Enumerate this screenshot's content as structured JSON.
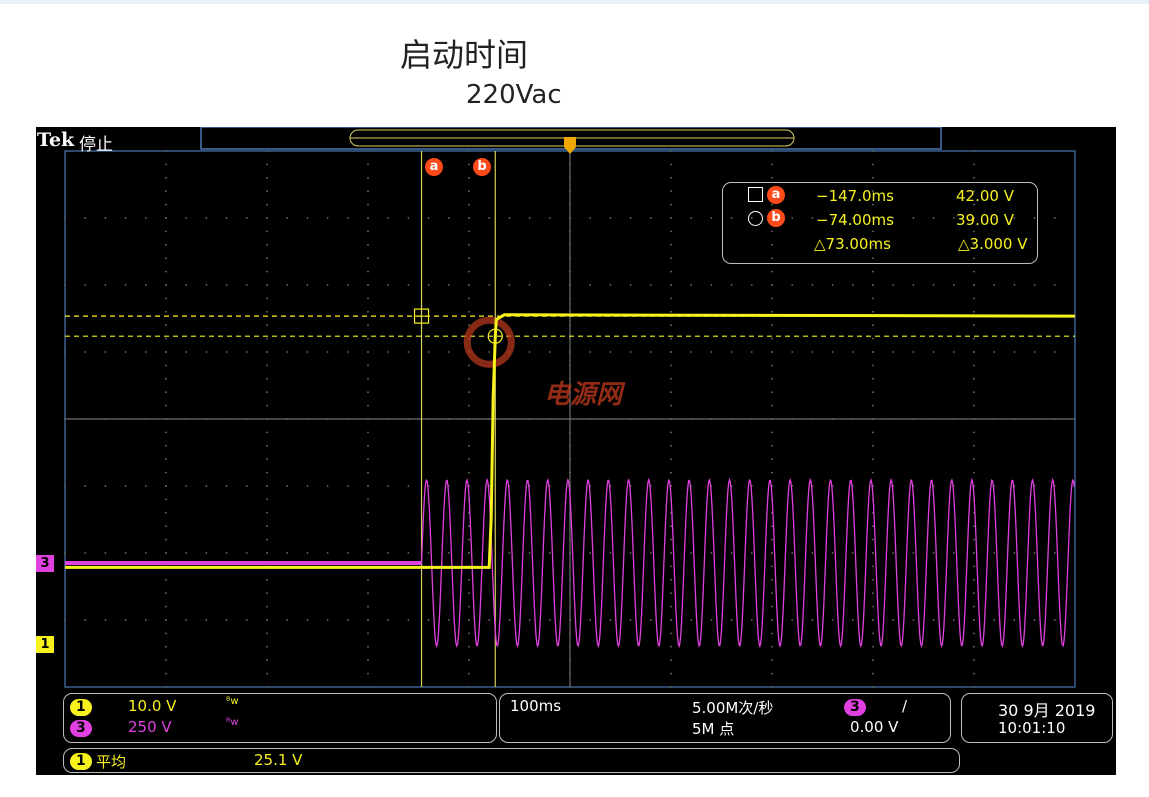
{
  "title": "启动时间",
  "subtitle": "220Vac",
  "scope": {
    "brand": "Tek",
    "status": "停止",
    "cursor_marker_a": "a",
    "cursor_marker_b": "b",
    "cursor_readout": {
      "a_time": "−147.0ms",
      "a_volt": "42.00 V",
      "b_time": "−74.00ms",
      "b_volt": "39.00 V",
      "delta_time": "△73.00ms",
      "delta_volt": "△3.000 V"
    },
    "ch1": {
      "label": "1",
      "scale": "10.0 V",
      "color": "#f7f21e"
    },
    "ch3": {
      "label": "3",
      "scale": "250 V",
      "color": "#e040e0"
    },
    "timebase": "100ms",
    "sample_rate": "5.00M次/秒",
    "record_length": "5M 点",
    "trigger_channel": "3",
    "trigger_slope": "/",
    "trigger_level": "0.00 V",
    "date": "30 9月 2019",
    "time": "10:01:10",
    "measurement_label": "平均",
    "measurement_value": "25.1 V",
    "watermark": "电源网"
  },
  "chart_data": {
    "type": "line",
    "x_unit": "ms",
    "time_per_div": 100,
    "series": [
      {
        "name": "1",
        "points": [
          [
            -500,
            4.5
          ],
          [
            -80,
            4.5
          ],
          [
            -78,
            12
          ],
          [
            -76,
            30
          ],
          [
            -74,
            39
          ],
          [
            -73,
            41.5
          ],
          [
            -65,
            42.2
          ],
          [
            500,
            42
          ]
        ]
      },
      {
        "name": "3",
        "description_kind": "sine",
        "off_value": 0,
        "start_ms": -147,
        "amplitude_v": 310,
        "frequency_hz": 50
      }
    ],
    "cursors": {
      "a_ms": -147.0,
      "b_ms": -74.0,
      "a_v": 42.0,
      "b_v": 39.0
    }
  }
}
